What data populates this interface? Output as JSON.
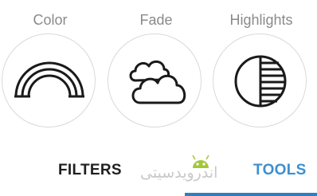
{
  "tools": [
    {
      "label": "Color",
      "icon": "rainbow-icon"
    },
    {
      "label": "Fade",
      "icon": "cloud-icon"
    },
    {
      "label": "Highlights",
      "icon": "highlights-icon"
    }
  ],
  "tabs": {
    "filters": "FILTERS",
    "tools": "TOOLS",
    "active": "tools"
  },
  "watermark": "اندرویدسیتی",
  "colors": {
    "accent": "#3d8fcf",
    "indicator": "#2f7fc0",
    "label": "#8a8a8a",
    "circle_border": "#d9d9d9",
    "icon_stroke": "#1a1a1a"
  }
}
